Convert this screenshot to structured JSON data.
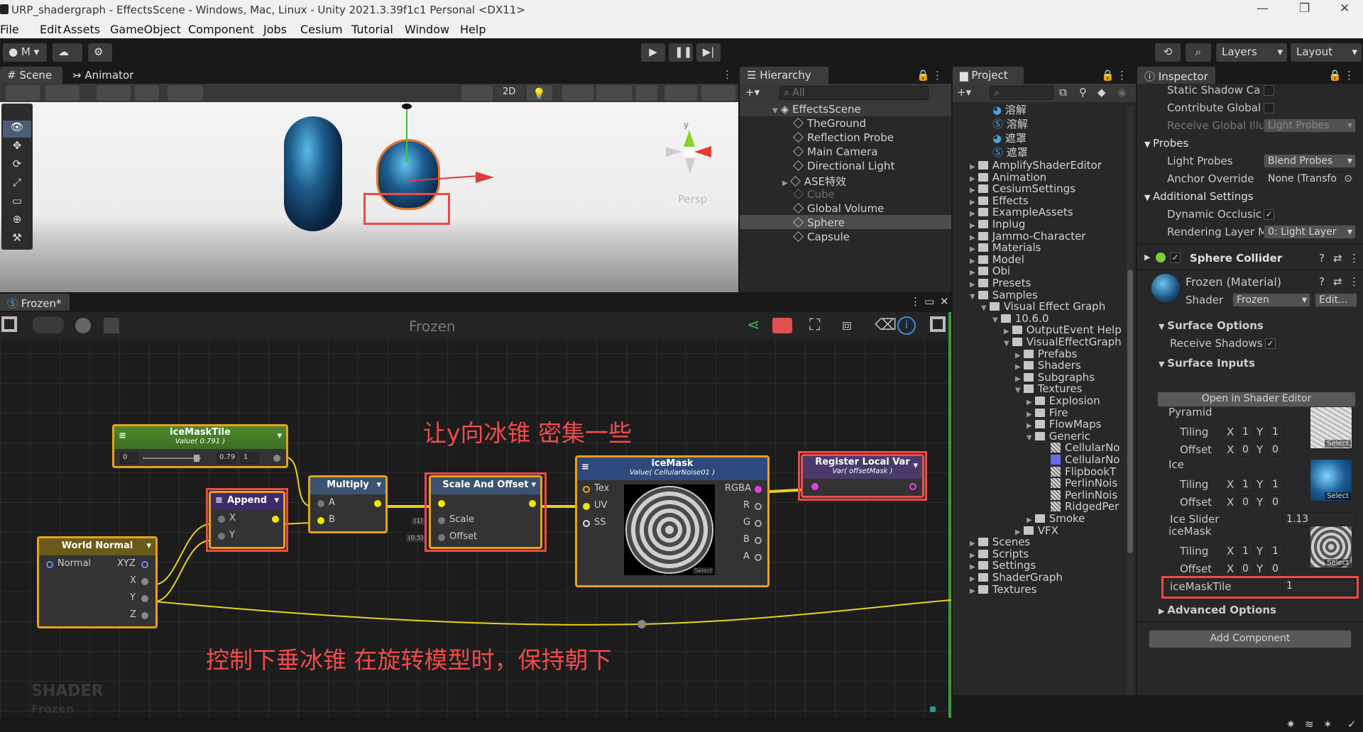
{
  "window": {
    "title": "URP_shadergraph - EffectsScene - Windows, Mac, Linux - Unity 2021.3.39f1c1 Personal <DX11>"
  },
  "menu": [
    "File",
    "Edit",
    "Assets",
    "GameObject",
    "Component",
    "Jobs",
    "Cesium",
    "Tutorial",
    "Window",
    "Help"
  ],
  "toolbar": {
    "account": "M",
    "layers": "Layers",
    "layout": "Layout"
  },
  "scene": {
    "tab_scene": "Scene",
    "tab_animator": "Animator",
    "btn_2d": "2D",
    "persp": "Persp",
    "gizmo_y": "y"
  },
  "hierarchy": {
    "tab": "Hierarchy",
    "search_placeholder": "All",
    "scene_name": "EffectsScene",
    "items": [
      "TheGround",
      "Reflection Probe",
      "Main Camera",
      "Directional Light",
      "ASE特效",
      "Cube",
      "Global Volume",
      "Sphere",
      "Capsule"
    ]
  },
  "project": {
    "tab": "Project",
    "shader_items": [
      "溶解",
      "溶解",
      "遮罩",
      "遮罩"
    ],
    "folders": [
      "AmplifyShaderEditor",
      "Animation",
      "CesiumSettings",
      "Effects",
      "ExampleAssets",
      "Inplug",
      "Jammo-Character",
      "Materials",
      "Model",
      "Obi",
      "Presets",
      "Samples",
      "Visual Effect Graph",
      "10.6.0",
      "OutputEvent Help",
      "VisualEffectGraph",
      "Prefabs",
      "Shaders",
      "Subgraphs",
      "Textures",
      "Explosion",
      "Fire",
      "FlowMaps",
      "Generic",
      "CellularNo",
      "CellularNo",
      "FlipbookT",
      "PerlinNois",
      "PerlinNois",
      "RidgedPer",
      "Smoke",
      "VFX",
      "Scenes",
      "Scripts",
      "Settings",
      "ShaderGraph",
      "Textures"
    ]
  },
  "inspector": {
    "tab": "Inspector",
    "static_shadow": "Static Shadow Ca",
    "contribute_global": "Contribute Global",
    "receive_global": "Receive Global Illu",
    "receive_global_value": "Light Probes",
    "probes": "Probes",
    "light_probes": "Light Probes",
    "light_probes_value": "Blend Probes",
    "anchor_override": "Anchor Override",
    "anchor_value": "None (Transfo",
    "additional_settings": "Additional Settings",
    "dynamic_occlusion": "Dynamic Occlusic",
    "rendering_layer": "Rendering Layer M",
    "rendering_layer_value": "0: Light Layer",
    "sphere_collider": "Sphere Collider",
    "material_name": "Frozen (Material)",
    "shader_label": "Shader",
    "shader_value": "Frozen",
    "edit_btn": "Edit...",
    "surface_options": "Surface Options",
    "receive_shadows": "Receive Shadows",
    "surface_inputs": "Surface Inputs",
    "open_shader_editor": "Open in Shader Editor",
    "textures": [
      {
        "name": "Pyramid",
        "tiling_x": "1",
        "tiling_y": "1",
        "offset_x": "0",
        "offset_y": "0"
      },
      {
        "name": "Ice",
        "tiling_x": "1",
        "tiling_y": "1",
        "offset_x": "0",
        "offset_y": "0"
      },
      {
        "name": "iceMask",
        "tiling_x": "1",
        "tiling_y": "1",
        "offset_x": "0",
        "offset_y": "0"
      }
    ],
    "tiling": "Tiling",
    "offset": "Offset",
    "x": "X",
    "y": "Y",
    "select": "Select",
    "ice_slider": "Ice Slider",
    "ice_slider_value": "1.13",
    "ice_mask_tile": "iceMaskTile",
    "ice_mask_tile_value": "1",
    "advanced_options": "Advanced Options",
    "add_component": "Add Component"
  },
  "graph": {
    "tab": "Frozen*",
    "title": "Frozen",
    "icemasktile": {
      "title": "iceMaskTile",
      "sub": "Value( 0.791 )",
      "min": "0",
      "val": "0.79",
      "max": "1"
    },
    "multiply": {
      "title": "Multiply",
      "a": "A",
      "b": "B"
    },
    "append": {
      "title": "Append",
      "x": "X",
      "y": "Y"
    },
    "scaleoffset": {
      "title": "Scale And Offset",
      "scale": "Scale",
      "offset": "Offset",
      "scale_val": "(1)",
      "offset_val": "(0.5)"
    },
    "worldnormal": {
      "title": "World Normal",
      "normal": "Normal",
      "xyz": "XYZ",
      "x": "X",
      "y": "Y",
      "z": "Z"
    },
    "icemask": {
      "title": "iceMask",
      "sub": "Value( CellularNoise01 )",
      "tex": "Tex",
      "uv": "UV",
      "ss": "SS",
      "rgba": "RGBA",
      "r": "R",
      "g": "G",
      "b": "B",
      "a": "A",
      "select": "Select"
    },
    "register": {
      "title": "Register Local Var",
      "sub": "Var( offsetMask )"
    },
    "annotation_top": "让y向冰锥 密集一些",
    "annotation_bottom": "控制下垂冰锥 在旋转模型时，保持朝下",
    "watermark": "SHADER",
    "watermark_sub": "Frozen"
  }
}
